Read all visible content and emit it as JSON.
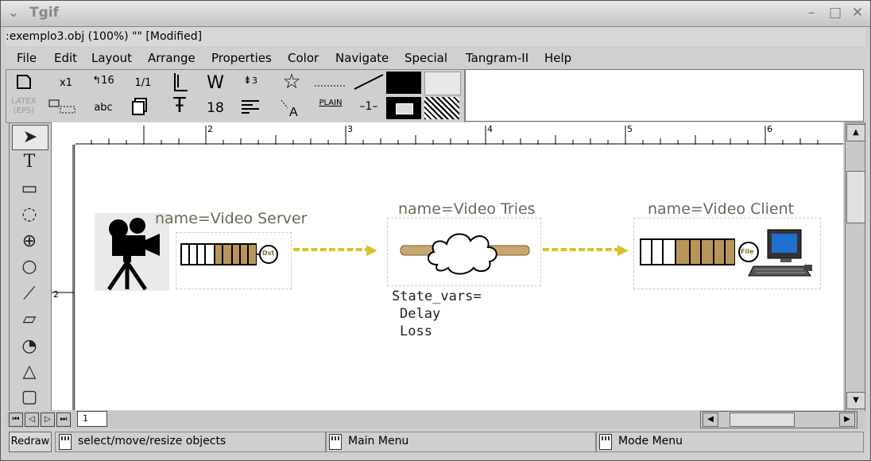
{
  "window": {
    "title": "Tgif"
  },
  "file_line": ":exemplo3.obj (100%) \"\" [Modified]",
  "menu": [
    "File",
    "Edit",
    "Layout",
    "Arrange",
    "Properties",
    "Color",
    "Navigate",
    "Special",
    "Tangram-II",
    "Help"
  ],
  "toolbox": {
    "zoom": "x1",
    "rotate": "16",
    "ratio": "1/1",
    "text_font": "W",
    "line_spacing": "3",
    "font_size": "18",
    "text_mode": "abc",
    "latex": "LATEX",
    "eps": "(EPS)",
    "pen_style": "PLAIN",
    "line_width": "1"
  },
  "rulers": {
    "h_ticks": [
      "2",
      "3",
      "4",
      "5",
      "6"
    ],
    "v_ticks": [
      "2"
    ]
  },
  "canvas": {
    "objects": [
      {
        "label": "name=Video Server",
        "badge": "Dst"
      },
      {
        "label": "name=Video Tries"
      },
      {
        "label": "name=Video Client",
        "badge": "File"
      }
    ],
    "state_vars": [
      "State_vars=",
      "Delay",
      "Loss"
    ],
    "colors": {
      "arrow": "#d9c326",
      "queue_fill": "#b8955a",
      "tube": "#c9a870"
    }
  },
  "page_tab": "1",
  "status": {
    "redraw": "Redraw",
    "left": "select/move/resize objects",
    "middle": "Main Menu",
    "right": "Mode Menu"
  }
}
